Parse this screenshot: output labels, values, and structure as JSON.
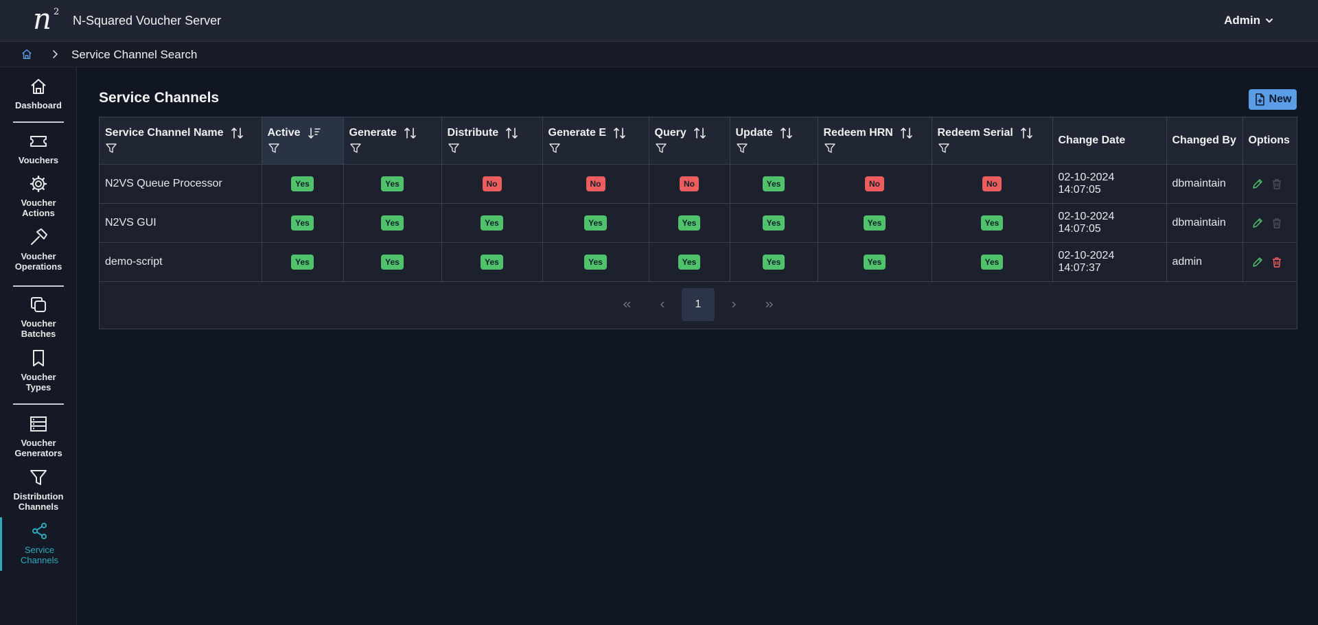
{
  "app": {
    "title": "N-Squared Voucher Server",
    "logo_n": "n",
    "logo_sup": "2",
    "user": "Admin"
  },
  "breadcrumb": {
    "current": "Service Channel Search"
  },
  "sidebar": {
    "items": [
      {
        "label_lines": [
          "Dashboard"
        ],
        "icon": "home-icon"
      },
      {
        "label_lines": [
          "Vouchers"
        ],
        "icon": "ticket-icon"
      },
      {
        "label_lines": [
          "Voucher",
          "Actions"
        ],
        "icon": "gear-icon"
      },
      {
        "label_lines": [
          "Voucher",
          "Operations"
        ],
        "icon": "hammer-icon"
      },
      {
        "label_lines": [
          "Voucher",
          "Batches"
        ],
        "icon": "copy-icon"
      },
      {
        "label_lines": [
          "Voucher",
          "Types"
        ],
        "icon": "bookmark-icon"
      },
      {
        "label_lines": [
          "Voucher",
          "Generators"
        ],
        "icon": "server-icon"
      },
      {
        "label_lines": [
          "Distribution",
          "Channels"
        ],
        "icon": "filter-icon"
      },
      {
        "label_lines": [
          "Service",
          "Channels"
        ],
        "icon": "share-icon",
        "active": true
      }
    ]
  },
  "page": {
    "title": "Service Channels",
    "new_label": "New"
  },
  "table": {
    "columns": [
      {
        "label": "Service Channel Name",
        "sortable": true,
        "filter": true
      },
      {
        "label": "Active",
        "sortable": true,
        "filter": true,
        "sorted": true
      },
      {
        "label": "Generate",
        "sortable": true,
        "filter": true
      },
      {
        "label": "Distribute",
        "sortable": true,
        "filter": true
      },
      {
        "label": "Generate E",
        "sortable": true,
        "filter": true
      },
      {
        "label": "Query",
        "sortable": true,
        "filter": true
      },
      {
        "label": "Update",
        "sortable": true,
        "filter": true
      },
      {
        "label": "Redeem HRN",
        "sortable": true,
        "filter": true
      },
      {
        "label": "Redeem Serial",
        "sortable": true,
        "filter": true
      },
      {
        "label": "Change Date",
        "sortable": false,
        "filter": false
      },
      {
        "label": "Changed By",
        "sortable": false,
        "filter": false
      },
      {
        "label": "Options",
        "sortable": false,
        "filter": false
      }
    ],
    "rows": [
      {
        "name": "N2VS Queue Processor",
        "flags": [
          "Yes",
          "Yes",
          "No",
          "No",
          "No",
          "Yes",
          "No",
          "No"
        ],
        "date": "02-10-2024",
        "time": "14:07:05",
        "changed_by": "dbmaintain",
        "can_delete": false
      },
      {
        "name": "N2VS GUI",
        "flags": [
          "Yes",
          "Yes",
          "Yes",
          "Yes",
          "Yes",
          "Yes",
          "Yes",
          "Yes"
        ],
        "date": "02-10-2024",
        "time": "14:07:05",
        "changed_by": "dbmaintain",
        "can_delete": false
      },
      {
        "name": "demo-script",
        "flags": [
          "Yes",
          "Yes",
          "Yes",
          "Yes",
          "Yes",
          "Yes",
          "Yes",
          "Yes"
        ],
        "date": "02-10-2024",
        "time": "14:07:37",
        "changed_by": "admin",
        "can_delete": true
      }
    ]
  },
  "pagination": {
    "current": "1",
    "first": "«",
    "prev": "‹",
    "next": "›",
    "last": "»"
  },
  "colors": {
    "accent": "#2fa9bf",
    "yes": "#4fc26b",
    "no": "#ee5d5d",
    "primary": "#5b9ce6"
  }
}
